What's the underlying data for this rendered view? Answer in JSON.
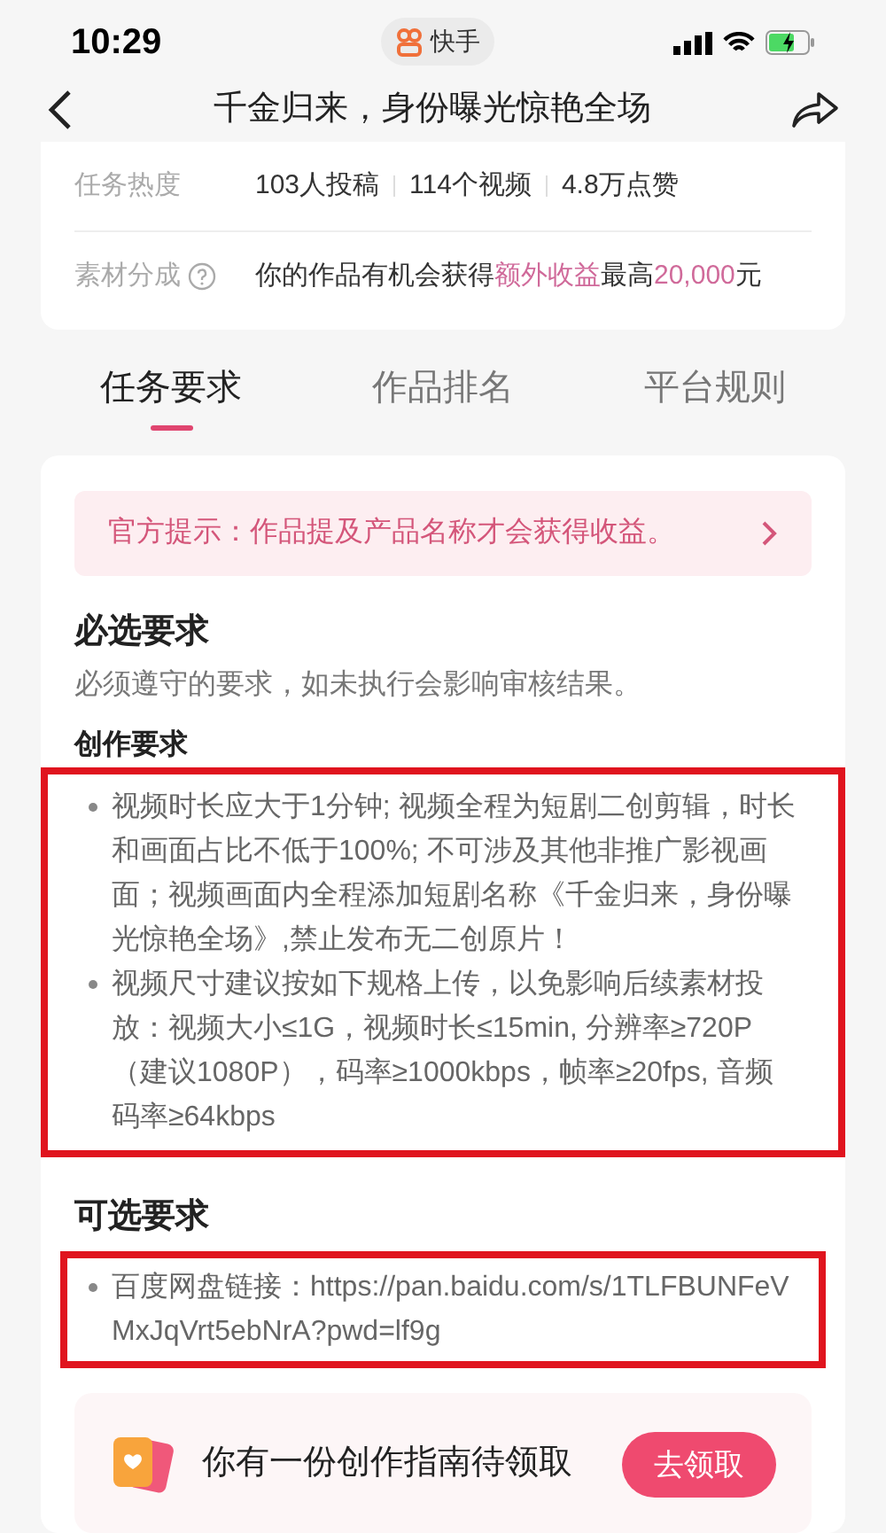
{
  "status_bar": {
    "time": "10:29",
    "app_badge": "快手"
  },
  "nav": {
    "title": "千金归来，身份曝光惊艳全场"
  },
  "info": [
    {
      "label": "任务热度",
      "kind": "stats",
      "values": [
        "103人投稿",
        "114个视频",
        "4.8万点赞"
      ]
    },
    {
      "label": "素材分成",
      "kind": "help",
      "text": "你的作品有机会获得**额外收益**最高**20,000**元"
    }
  ],
  "tabs": [
    {
      "label": "任务要求",
      "selected": true
    },
    {
      "label": "作品排名",
      "selected": false
    },
    {
      "label": "平台规则",
      "selected": false
    }
  ],
  "tip": {
    "text": "官方提示：作品提及产品名称才会获得收益。"
  },
  "required": {
    "title": "必选要求",
    "description": "必须遵守的要求，如未执行会影响审核结果。",
    "subtitle": "创作要求",
    "highlighted": true,
    "items": [
      "视频时长应大于1分钟; 视频全程为短剧二创剪辑，时长和画面占比不低于100%; 不可涉及其他非推广影视画面；视频画面内全程添加短剧名称《千金归来，身份曝光惊艳全场》,禁止发布无二创原片！",
      "视频尺寸建议按如下规格上传，以免影响后续素材投放：视频大小≤1G，视频时长≤15min, 分辨率≥720P（建议1080P），码率≥1000kbps，帧率≥20fps, 音频码率≥64kbps"
    ]
  },
  "optional": {
    "title": "可选要求",
    "highlighted": true,
    "items": [
      "百度网盘链接：https://pan.baidu.com/s/1TLFBUNFeVMxJqVrt5ebNrA?pwd=lf9g"
    ]
  },
  "guide": {
    "title": "你有一份创作指南待领取",
    "button": "去领取"
  }
}
